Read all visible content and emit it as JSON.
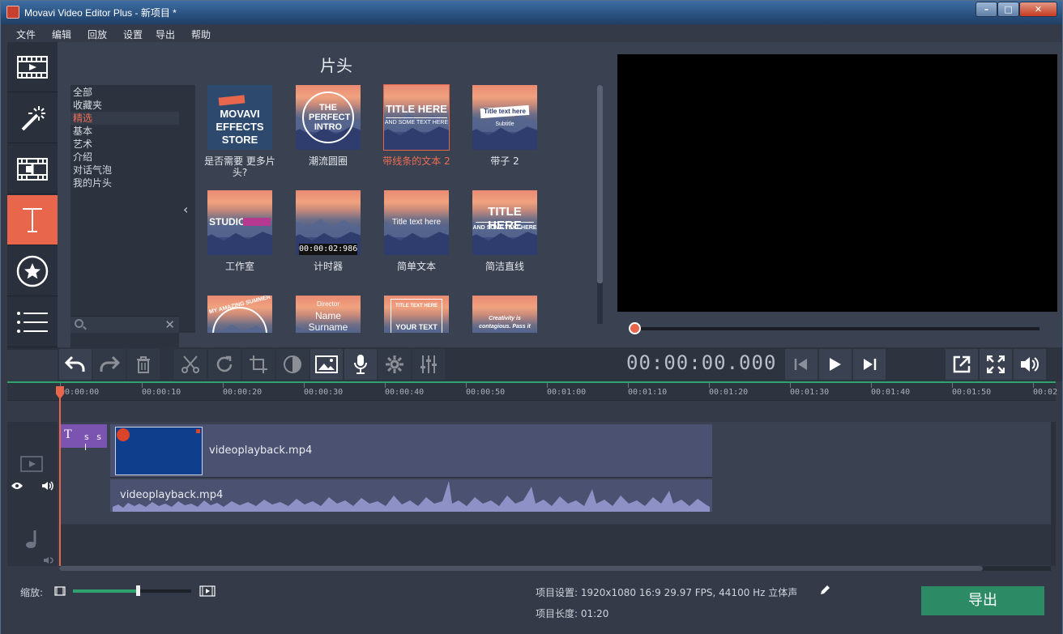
{
  "window": {
    "title": "Movavi Video Editor Plus - 新项目 *"
  },
  "menu": [
    "文件",
    "编辑",
    "回放",
    "设置",
    "导出",
    "帮助"
  ],
  "sidebar": {
    "items": [
      {
        "name": "import",
        "icon": "film-import-icon"
      },
      {
        "name": "filters",
        "icon": "magic-wand-icon"
      },
      {
        "name": "transitions",
        "icon": "transition-icon"
      },
      {
        "name": "titles",
        "icon": "text-title-icon",
        "active": true
      },
      {
        "name": "stickers",
        "icon": "star-sticker-icon"
      },
      {
        "name": "more",
        "icon": "list-icon"
      }
    ]
  },
  "titles_panel": {
    "heading": "片头",
    "categories": [
      "全部",
      "收藏夹",
      "精选",
      "基本",
      "艺术",
      "介绍",
      "对话气泡",
      "我的片头"
    ],
    "selected_category": "精选",
    "tiles": [
      {
        "label": "是否需要 更多片头?",
        "thumb_text": "MOVAVI EFFECTS STORE"
      },
      {
        "label": "潮流圆圈",
        "thumb_text": "THE PERFECT INTRO"
      },
      {
        "label": "带线条的文本 2",
        "thumb_text": "TITLE HERE",
        "thumb_subtext": "AND SOME TEXT HERE",
        "selected": true
      },
      {
        "label": "带子 2",
        "thumb_text": "Title text here",
        "thumb_subtext": "Subtitle"
      },
      {
        "label": "工作室",
        "thumb_text": "STUDIO"
      },
      {
        "label": "计时器",
        "thumb_text": "00:00:02:986"
      },
      {
        "label": "简单文本",
        "thumb_text": "Title text here"
      },
      {
        "label": "简洁直线",
        "thumb_text": "TITLE HERE",
        "thumb_subtext": "AND SOME TEXT HERE"
      },
      {
        "label": "",
        "thumb_text": "MY AMAZING SUMMER"
      },
      {
        "label": "",
        "thumb_text": "Name Surname",
        "thumb_subtext": "Director"
      },
      {
        "label": "",
        "thumb_text": "YOUR TEXT",
        "thumb_subtext": "TITLE TEXT HERE"
      },
      {
        "label": "",
        "thumb_text": "Creativity is contagious. Pass it on."
      }
    ]
  },
  "player": {
    "timecode": "00:00:00.000"
  },
  "timeline": {
    "ruler": [
      "00:00:00",
      "00:00:10",
      "00:00:20",
      "00:00:30",
      "00:00:40",
      "00:00:50",
      "00:01:00",
      "00:01:10",
      "00:01:20",
      "00:01:30",
      "00:01:40",
      "00:01:50",
      "00:02"
    ],
    "title_clip_text": "T",
    "title_clip_sub": "s s l",
    "video_clip_name": "videoplayback.mp4",
    "audio_clip_name": "videoplayback.mp4"
  },
  "bottom": {
    "zoom_label": "缩放:",
    "zoom_level": 0.55,
    "project_settings": "项目设置:   1920x1080 16:9 29.97 FPS, 44100 Hz 立体声",
    "project_length": "项目长度:   01:20",
    "export_label": "导出"
  },
  "colors": {
    "accent": "#e8674c",
    "green": "#2ea36e",
    "export": "#2c8a65",
    "clip": "#4b5170",
    "title_clip": "#7a54b0"
  }
}
